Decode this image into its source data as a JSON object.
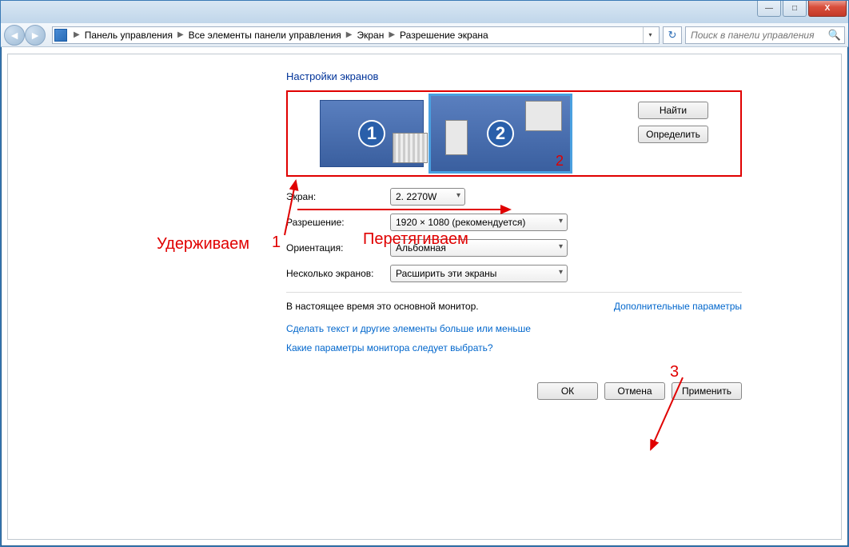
{
  "titlebar": {
    "minimize_glyph": "—",
    "maximize_glyph": "□",
    "close_glyph": "X"
  },
  "nav": {
    "back_glyph": "◄",
    "forward_glyph": "►",
    "crumbs": [
      "Панель управления",
      "Все элементы панели управления",
      "Экран",
      "Разрешение экрана"
    ],
    "dropdown_glyph": "▾",
    "refresh_glyph": "↻"
  },
  "search": {
    "placeholder": "Поиск в панели управления",
    "icon_glyph": "🔍"
  },
  "page": {
    "title": "Настройки экранов"
  },
  "preview": {
    "monitor1_label": "1",
    "monitor2_label": "2",
    "monitor2_corner": "2",
    "find_btn": "Найти",
    "detect_btn": "Определить"
  },
  "annotations": {
    "hold_text": "Удерживаем",
    "drag_text": "Перетягиваем",
    "num1": "1",
    "num3": "3"
  },
  "fields": {
    "screen_label": "Экран:",
    "screen_value": "2. 2270W",
    "resolution_label": "Разрешение:",
    "resolution_value": "1920 × 1080 (рекомендуется)",
    "orientation_label": "Ориентация:",
    "orientation_value": "Альбомная",
    "multi_label": "Несколько экранов:",
    "multi_value": "Расширить эти экраны"
  },
  "status": {
    "primary_text": "В настоящее время это основной монитор.",
    "advanced_link": "Дополнительные параметры"
  },
  "links": {
    "resize_link": "Сделать текст и другие элементы больше или меньше",
    "which_link": "Какие параметры монитора следует выбрать?"
  },
  "buttons": {
    "ok": "ОК",
    "cancel": "Отмена",
    "apply": "Применить"
  }
}
